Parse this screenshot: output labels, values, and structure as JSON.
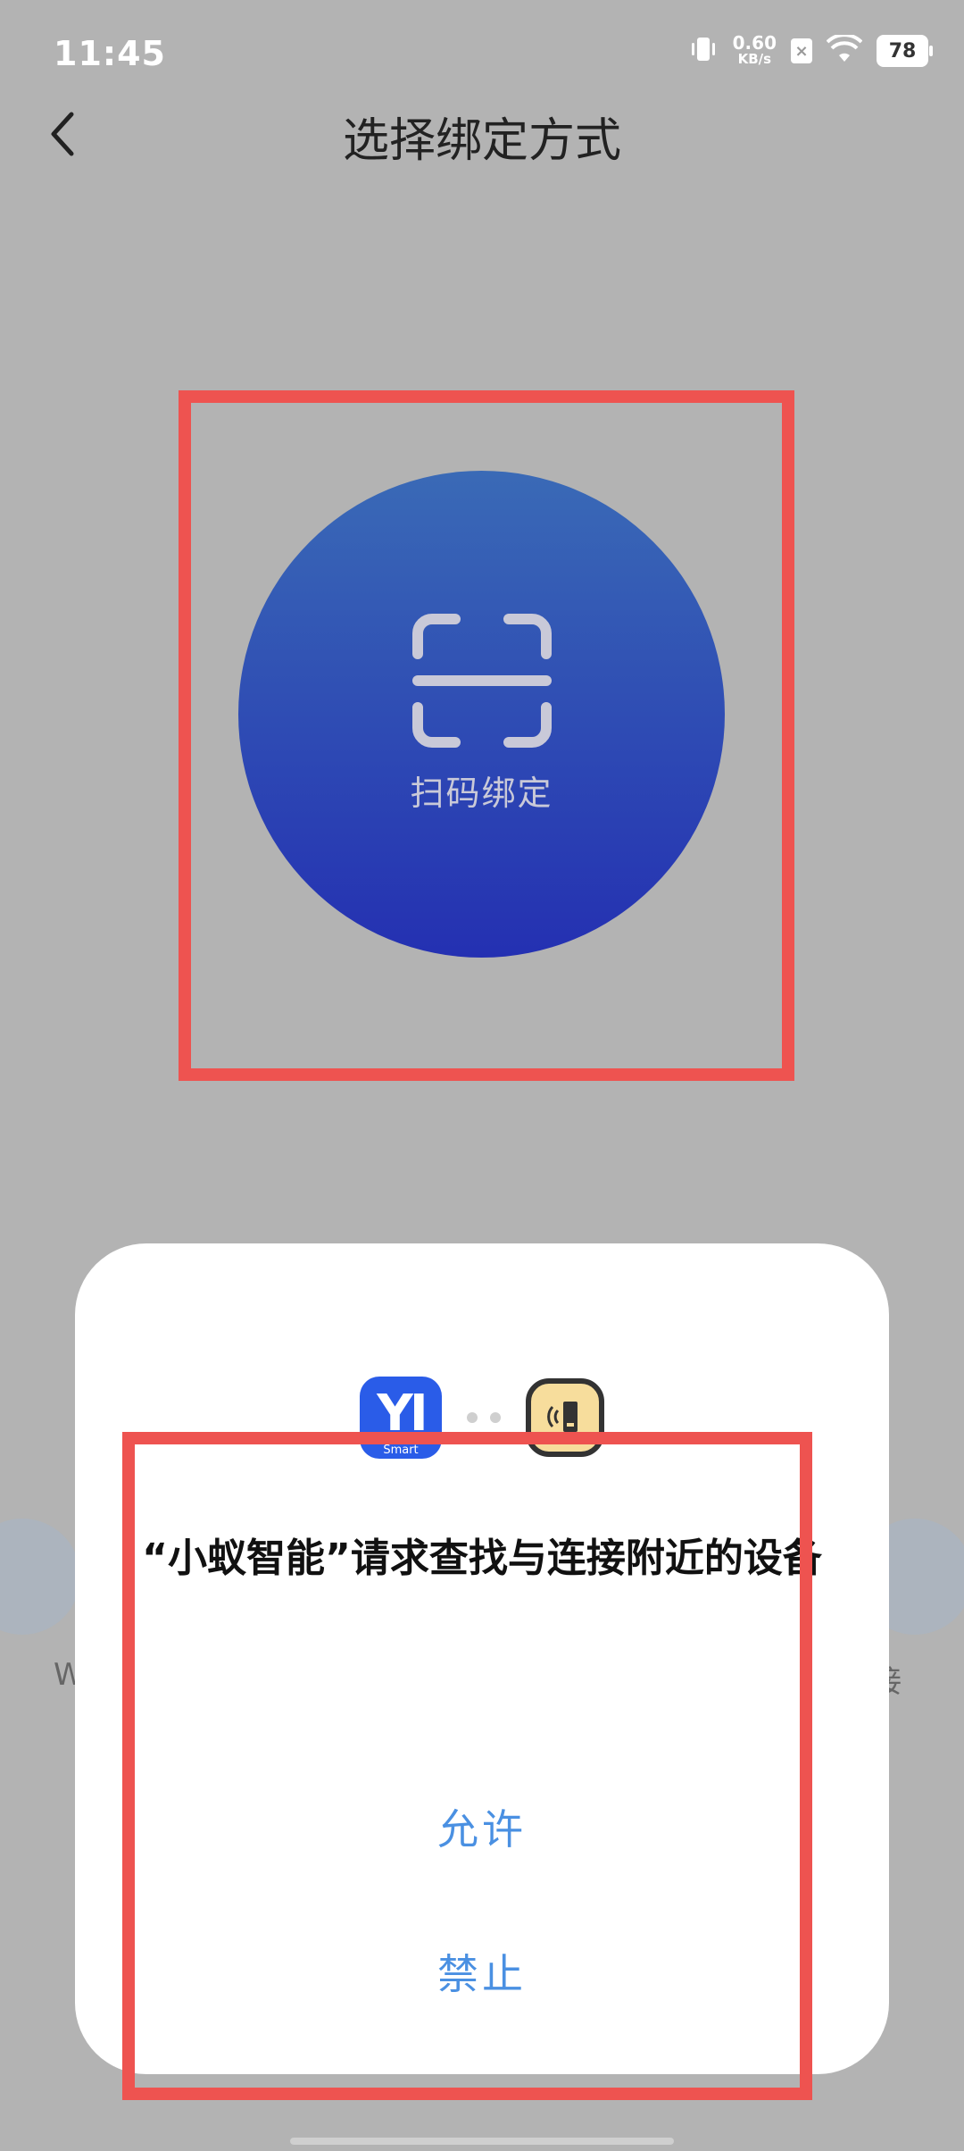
{
  "status_bar": {
    "time": "11:45",
    "net_speed_value": "0.60",
    "net_speed_unit": "KB/s",
    "battery": "78"
  },
  "header": {
    "title": "选择绑定方式"
  },
  "scan": {
    "label": "扫码绑定"
  },
  "background_hints": {
    "left_text": "W",
    "right_text": "接"
  },
  "dialog": {
    "app_icon_text": "YI",
    "app_icon_subtext": "Smart",
    "title": "“小蚁智能”请求查找与连接附近的设备",
    "allow_label": "允许",
    "deny_label": "禁止"
  },
  "colors": {
    "overlay": "#b3b3b3",
    "highlight_border": "#ee5350",
    "button_text": "#4a90e2",
    "circle_top": "#3a6ab6",
    "circle_bottom": "#2430b2"
  }
}
